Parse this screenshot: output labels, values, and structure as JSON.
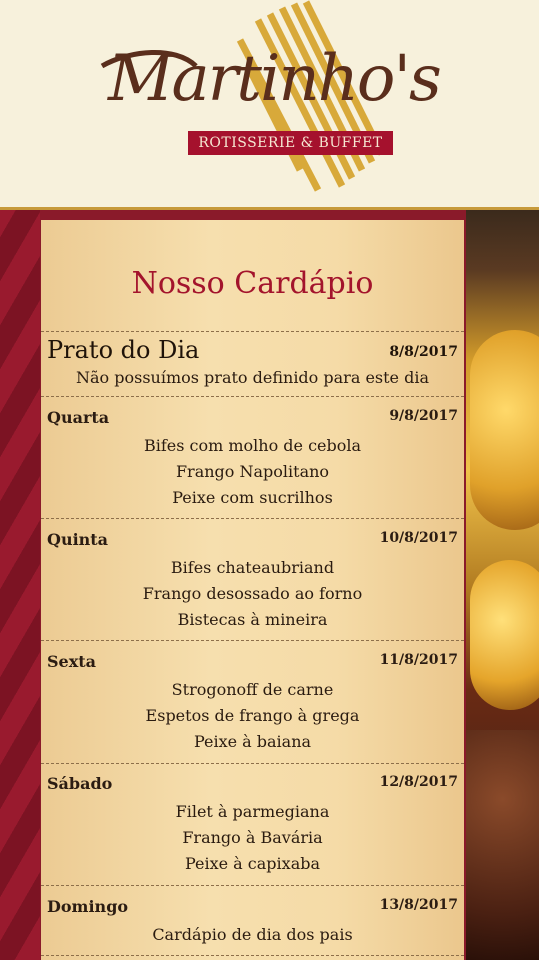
{
  "brand": {
    "name": "Martinho's",
    "subtitle": "ROTISSERIE & BUFFET"
  },
  "menu": {
    "title": "Nosso Cardápio",
    "prato_do_dia": {
      "label": "Prato do Dia",
      "date": "8/8/2017",
      "text": "Não possuímos prato definido para este dia"
    },
    "days": [
      {
        "name": "Quarta",
        "date": "9/8/2017",
        "items": [
          "Bifes com molho de cebola",
          "Frango Napolitano",
          "Peixe com sucrilhos"
        ]
      },
      {
        "name": "Quinta",
        "date": "10/8/2017",
        "items": [
          "Bifes chateaubriand",
          "Frango desossado ao forno",
          "Bistecas à mineira"
        ]
      },
      {
        "name": "Sexta",
        "date": "11/8/2017",
        "items": [
          "Strogonoff de carne",
          "Espetos de frango à grega",
          "Peixe à baiana"
        ]
      },
      {
        "name": "Sábado",
        "date": "12/8/2017",
        "items": [
          "Filet à parmegiana",
          "Frango à Bavária",
          "Peixe à capixaba"
        ]
      },
      {
        "name": "Domingo",
        "date": "13/8/2017",
        "items": [
          "Cardápio de dia dos pais"
        ]
      }
    ]
  },
  "colors": {
    "brand_red": "#a5112d",
    "brand_brown": "#5a2e1c",
    "gold": "#d8a93a",
    "card": "#f5dba7"
  }
}
